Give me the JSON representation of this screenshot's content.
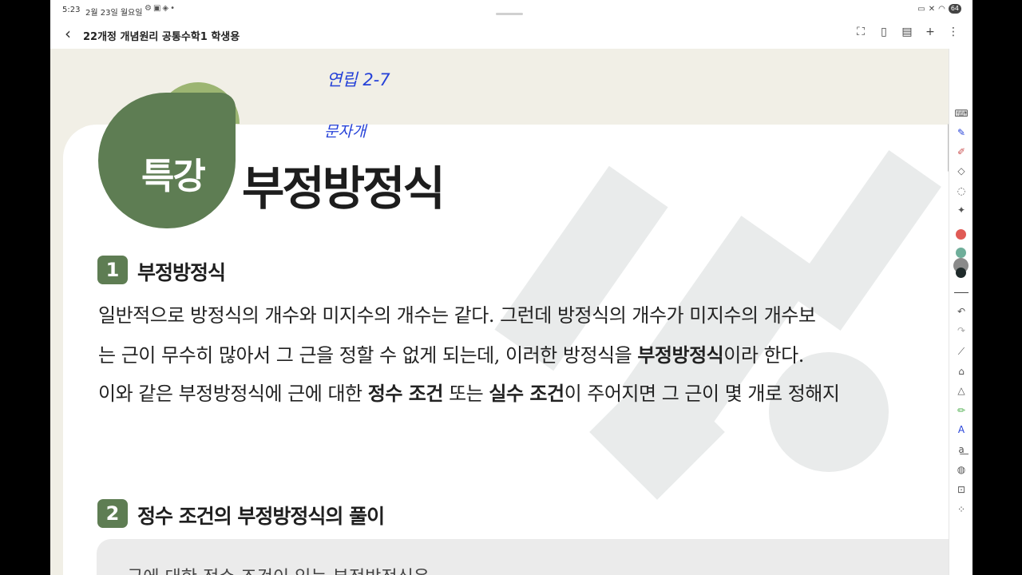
{
  "status_bar": {
    "time": "5:23",
    "date": "2월 23일 월요일",
    "battery": "64"
  },
  "toolbar": {
    "title": "22개정 개념원리 공통수학1 학생용"
  },
  "document": {
    "handwriting_1": "연립 2-7",
    "handwriting_2": "문자개",
    "badge": "특강",
    "title": "부정방정식",
    "section1": {
      "number": "1",
      "title": "부정방정식",
      "line1": "일반적으로 방정식의 개수와 미지수의 개수는 같다. 그런데 방정식의 개수가 미지수의 개수보",
      "line2_a": "는 근이 무수히 많아서 그 근을 정할 수 없게 되는데, 이러한 방정식을 ",
      "line2_b": "부정방정식",
      "line2_c": "이라 한다.",
      "line3_a": "이와 같은 부정방정식에 근에 대한 ",
      "line3_b": "정수 조건",
      "line3_c": " 또는 ",
      "line3_d": "실수 조건",
      "line3_e": "이 주어지면 그 근이 몇 개로 정해지"
    },
    "section2": {
      "number": "2",
      "title": "정수 조건의 부정방정식의 풀이",
      "box_text": "근에 대한 정수 조건이 있는 부정방정식은"
    }
  },
  "colors": {
    "accent_green": "#5e7d53",
    "light_green": "#9cb572",
    "page_beige": "#f1efe6",
    "pen_blue": "#2642d8"
  },
  "palette_colors": [
    "#e05a55",
    "#6fae9a",
    "#8a8a8a",
    "#1f2a2a"
  ]
}
